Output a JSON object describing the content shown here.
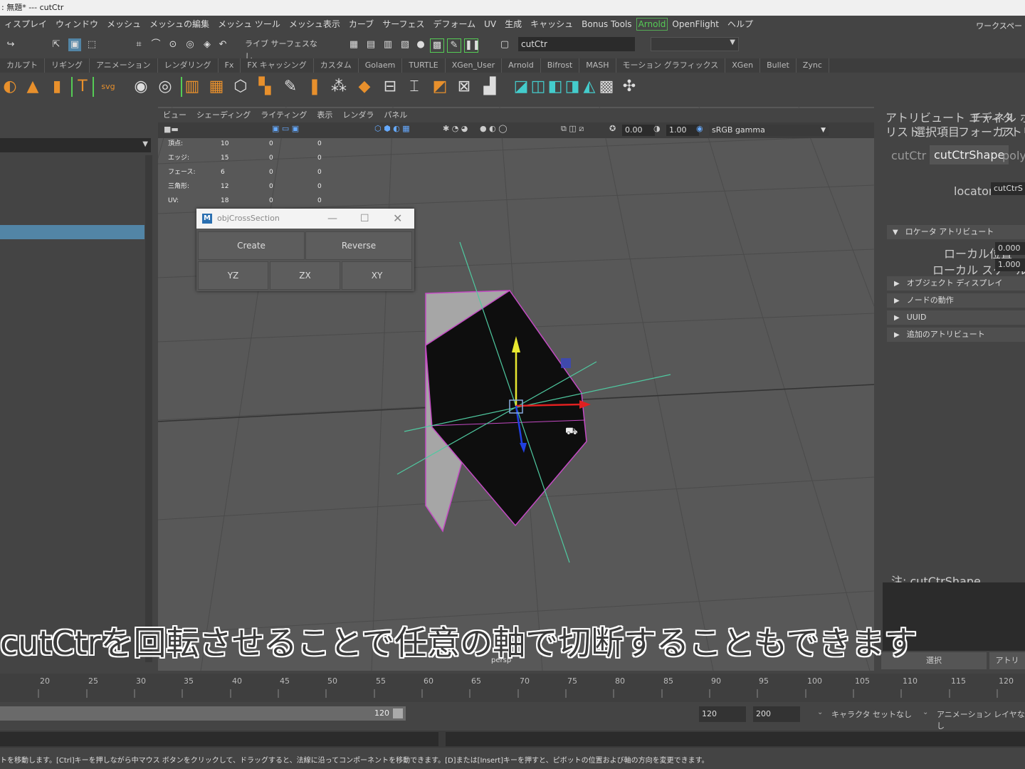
{
  "title_bar": {
    "text": ": 無題* --- cutCtr"
  },
  "menu": [
    "ィスプレイ",
    "ウィンドウ",
    "メッシュ",
    "メッシュの編集",
    "メッシュ ツール",
    "メッシュ表示",
    "カーブ",
    "サーフェス",
    "デフォーム",
    "UV",
    "生成",
    "キャッシュ",
    "Bonus Tools",
    "Arnold",
    "OpenFlight",
    "ヘルプ"
  ],
  "workspace_label": "ワークスペー",
  "status_line": {
    "live_label": "ライブ サーフェスなし",
    "object_field": "cutCtr"
  },
  "shelf_tabs": [
    "カルプト",
    "リギング",
    "アニメーション",
    "レンダリング",
    "Fx",
    "FX キャッシング",
    "カスタム",
    "Golaem",
    "TURTLE",
    "XGen_User",
    "Arnold",
    "Bifrost",
    "MASH",
    "モーション グラフィックス",
    "XGen",
    "Bullet",
    "Zync"
  ],
  "shelf_icons": [
    "sculpt-icon",
    "cone-icon",
    "cylinder-icon",
    "text-icon",
    "svg-icon",
    "sphere-icon",
    "disc-icon",
    "mesh-icon",
    "grid-icon",
    "cube-icon",
    "blocks-icon",
    "pencil-icon",
    "torus-icon",
    "scatter-icon",
    "box-icon",
    "extrude-icon",
    "bevel-icon",
    "bridge-icon",
    "append-icon",
    "merge-icon",
    "fill-icon",
    "combine-icon",
    "separate-icon",
    "smooth-icon",
    "triangulate-icon",
    "mirror-icon",
    "uv-icon",
    "sewing-icon"
  ],
  "viewport": {
    "menu": [
      "ビュー",
      "シェーディング",
      "ライティング",
      "表示",
      "レンダラ",
      "パネル"
    ],
    "toolbar": {
      "exposure": "0.00",
      "gamma": "1.00",
      "color_space": "sRGB gamma"
    },
    "hud": [
      {
        "label": "頂点:",
        "values": [
          "10",
          "0",
          "0"
        ]
      },
      {
        "label": "エッジ:",
        "values": [
          "15",
          "0",
          "0"
        ]
      },
      {
        "label": "フェース:",
        "values": [
          "6",
          "0",
          "0"
        ]
      },
      {
        "label": "三角形:",
        "values": [
          "12",
          "0",
          "0"
        ]
      },
      {
        "label": "UV:",
        "values": [
          "18",
          "0",
          "0"
        ]
      }
    ],
    "camera_label": "persp"
  },
  "dialog": {
    "title": "objCrossSection",
    "buttons_row1": [
      "Create",
      "Reverse"
    ],
    "buttons_row2": [
      "YZ",
      "ZX",
      "XY"
    ]
  },
  "attribute_editor": {
    "tabs": [
      "アトリビュート エディタ",
      "チャネル ボックス"
    ],
    "menu": [
      "リスト",
      "選択項目",
      "フォーカス",
      "アトリビ"
    ],
    "node_tabs": [
      "cutCtr",
      "cutCtrShape",
      "polyC"
    ],
    "locator_label": "locator:",
    "locator_value": "cutCtrS",
    "sections": [
      "ロケータ アトリビュート",
      "オブジェクト ディスプレイ",
      "ノードの動作",
      "UUID",
      "追加のアトリビュート"
    ],
    "local_position_label": "ローカル位置",
    "local_position_value": "0.000",
    "local_scale_label": "ローカル スケール",
    "local_scale_value": "1.000",
    "note": "注: cutCtrShape",
    "select_button": "選択",
    "attr_button": "アトリ"
  },
  "timeline": {
    "ticks": [
      "20",
      "25",
      "30",
      "35",
      "40",
      "45",
      "50",
      "55",
      "60",
      "65",
      "70",
      "75",
      "80",
      "85",
      "90",
      "95",
      "100",
      "105",
      "110",
      "115",
      "120"
    ]
  },
  "range": {
    "current_end": "120",
    "playback_end": "120",
    "anim_end": "200",
    "character_set": "キャラクタ セットなし",
    "anim_layer": "アニメーション レイヤなし"
  },
  "help_line": "トを移動します。[Ctrl]キーを押しながら中マウス ボタンをクリックして、ドラッグすると、法線に沿ってコンポーネントを移動できます。[D]または[Insert]キーを押すと、ピボットの位置および軸の方向を変更できます。",
  "subtitle": "cutCtrを回転させることで任意の軸で切断することもできます"
}
